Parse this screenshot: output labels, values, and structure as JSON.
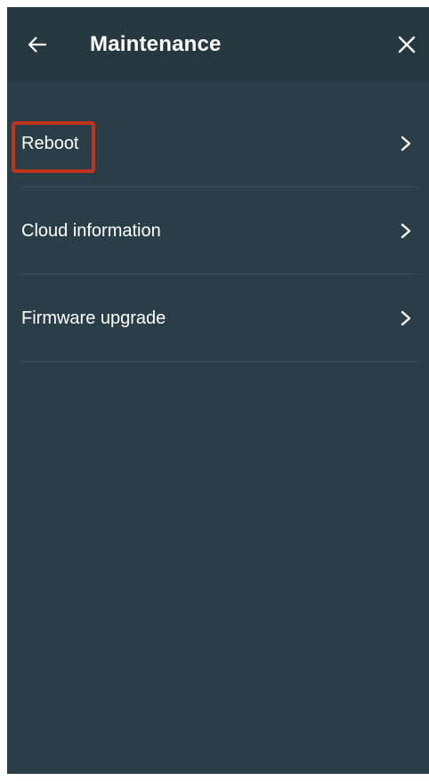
{
  "header": {
    "title": "Maintenance",
    "back_icon": "arrow-left-icon",
    "close_icon": "close-icon"
  },
  "menu": {
    "items": [
      {
        "label": "Reboot",
        "icon": "chevron-right-icon",
        "highlighted": true
      },
      {
        "label": "Cloud information",
        "icon": "chevron-right-icon",
        "highlighted": false
      },
      {
        "label": "Firmware upgrade",
        "icon": "chevron-right-icon",
        "highlighted": false
      }
    ]
  },
  "colors": {
    "background": "#2a3e48",
    "header_background": "#253840",
    "text": "#ffffff",
    "divider": "#3a4f59",
    "highlight": "#c0341c"
  }
}
